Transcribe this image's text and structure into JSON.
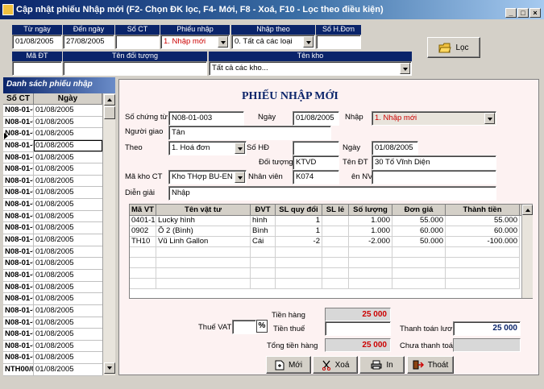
{
  "window": {
    "title": "Cập nhật phiếu  Nhập mới (F2- Chọn ĐK lọc, F4- Mới, F8 - Xoá, F10 - Lọc theo điều kiện)",
    "min": "_",
    "max": "□",
    "close": "×"
  },
  "filter": {
    "headers": {
      "tu_ngay": "Từ ngày",
      "den_ngay": "Đến ngày",
      "so_ct": "Số CT",
      "phieu_nhap": "Phiếu nhập",
      "nhap_theo": "Nhập theo",
      "so_hdon": "Số H.Đơn",
      "ma_dt": "Mã ĐT",
      "ten_doi_tuong": "Tên đối tượng",
      "ten_kho": "Tên kho"
    },
    "tu_ngay": "01/08/2005",
    "den_ngay": "27/08/2005",
    "so_ct": "",
    "phieu_nhap": "1. Nhập mới",
    "nhap_theo": "0. Tất cả các loại",
    "so_hdon": "",
    "ma_dt": "",
    "ten_doi_tuong": "",
    "ten_kho": "Tất cả các kho...",
    "filter_button": "Lọc"
  },
  "list": {
    "title": "Danh sách phiếu nhập",
    "col_so_ct": "Số CT",
    "col_ngay": "Ngày",
    "rows": [
      {
        "so_ct": "N08-01-0",
        "ngay": "01/08/2005"
      },
      {
        "so_ct": "N08-01-0",
        "ngay": "01/08/2005"
      },
      {
        "so_ct": "N08-01-0",
        "ngay": "01/08/2005"
      },
      {
        "so_ct": "N08-01-0",
        "ngay": "01/08/2005"
      },
      {
        "so_ct": "N08-01-0",
        "ngay": "01/08/2005"
      },
      {
        "so_ct": "N08-01-0",
        "ngay": "01/08/2005"
      },
      {
        "so_ct": "N08-01-0",
        "ngay": "01/08/2005"
      },
      {
        "so_ct": "N08-01-0",
        "ngay": "01/08/2005"
      },
      {
        "so_ct": "N08-01-0",
        "ngay": "01/08/2005"
      },
      {
        "so_ct": "N08-01-0",
        "ngay": "01/08/2005"
      },
      {
        "so_ct": "N08-01-0",
        "ngay": "01/08/2005"
      },
      {
        "so_ct": "N08-01-0",
        "ngay": "01/08/2005"
      },
      {
        "so_ct": "N08-01-0",
        "ngay": "01/08/2005"
      },
      {
        "so_ct": "N08-01-0",
        "ngay": "01/08/2005"
      },
      {
        "so_ct": "N08-01-0",
        "ngay": "01/08/2005"
      },
      {
        "so_ct": "N08-01-0",
        "ngay": "01/08/2005"
      },
      {
        "so_ct": "N08-01-0",
        "ngay": "01/08/2005"
      },
      {
        "so_ct": "N08-01-0",
        "ngay": "01/08/2005"
      },
      {
        "so_ct": "N08-01-0",
        "ngay": "01/08/2005"
      },
      {
        "so_ct": "N08-01-0",
        "ngay": "01/08/2005"
      },
      {
        "so_ct": "N08-01-0",
        "ngay": "01/08/2005"
      },
      {
        "so_ct": "N08-01-0",
        "ngay": "01/08/2005"
      },
      {
        "so_ct": "NTH00/0",
        "ngay": "01/08/2005"
      }
    ]
  },
  "form": {
    "title": "PHIẾU  NHẬP MỚI",
    "so_chung_tu_label": "Số chứng từ",
    "so_chung_tu": "N08-01-003",
    "ngay_label": "Ngày",
    "ngay": "01/08/2005",
    "nhap_label": "Nhập",
    "nhap": "1. Nhập mới",
    "nguoi_giao_label": "Người giao",
    "nguoi_giao": "Tân",
    "theo_label": "Theo",
    "theo": "1. Hoá đơn",
    "so_hd_label": "Số HĐ",
    "so_hd": "",
    "ngay_hd_label": "Ngày",
    "ngay_hd": "01/08/2005",
    "doi_tuong_label": "Đối tượng",
    "doi_tuong": "KTVD",
    "ten_dt_label": "Tên ĐT",
    "ten_dt": "30 Tố Vĩnh Diện",
    "ma_kho_label": "Mã kho CT",
    "ma_kho": "Kho THợp BU-EN",
    "nhan_vien_label": "Nhân viên",
    "nhan_vien": "K074",
    "ten_nv_label": "ên NV",
    "ten_nv": "",
    "dien_giai_label": "Diễn giải",
    "dien_giai": "Nhập"
  },
  "grid": {
    "headers": [
      "Mã VT",
      "Tên vật tư",
      "ĐVT",
      "SL quy đổi",
      "SL lẻ",
      "Số lượng",
      "Đơn giá",
      "Thành tiền"
    ],
    "rows": [
      [
        "0401-1",
        "Lucky hình",
        "hình",
        "1",
        "",
        "1.000",
        "55.000",
        "55.000"
      ],
      [
        "0902",
        "Ô 2 (Bình)",
        "Bình",
        "1",
        "",
        "1.000",
        "60.000",
        "60.000"
      ],
      [
        "TH10",
        "Vũ Linh Gallon",
        "Cái",
        "-2",
        "",
        "-2.000",
        "50.000",
        "-100.000"
      ]
    ]
  },
  "totals": {
    "tien_hang_label": "Tiền hàng",
    "tien_hang": "25 000",
    "thue_vat_label": "Thuế VAT",
    "thue_vat": "",
    "percent": "%",
    "tien_thue_label": "Tiền thuế",
    "tien_thue": "",
    "tong_tien_label": "Tổng tiền hàng",
    "tong_tien": "25 000",
    "thanh_toan_label": "Thanh toán lươi",
    "thanh_toan": "25 000",
    "chua_tt_label": "Chưa thanh toán",
    "chua_tt": ""
  },
  "buttons": {
    "moi": "Mới",
    "xoa": "Xoá",
    "in": "In",
    "thoat": "Thoát"
  }
}
